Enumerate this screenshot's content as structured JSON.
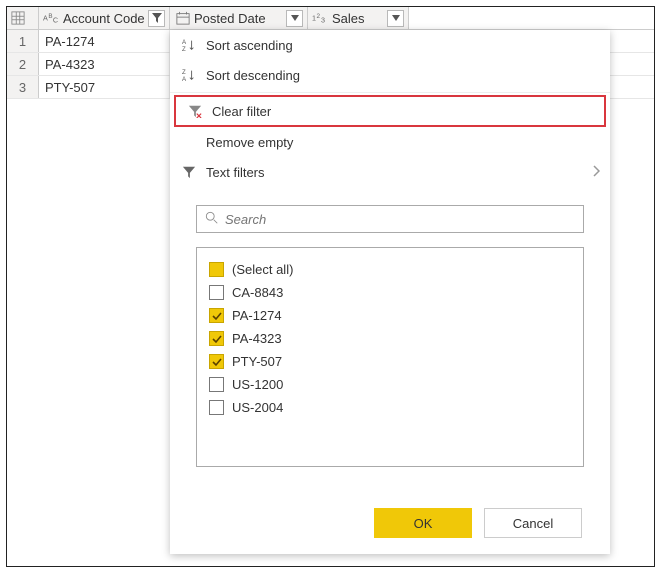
{
  "columns": {
    "c1": {
      "label": "Account Code",
      "datatype": "ABC"
    },
    "c2": {
      "label": "Posted Date",
      "datatype": "date"
    },
    "c3": {
      "label": "Sales",
      "datatype": "123"
    }
  },
  "rows": [
    "PA-1274",
    "PA-4323",
    "PTY-507"
  ],
  "menu": {
    "sort_asc": "Sort ascending",
    "sort_desc": "Sort descending",
    "clear_filter": "Clear filter",
    "remove_empty": "Remove empty",
    "text_filters": "Text filters"
  },
  "search": {
    "placeholder": "Search"
  },
  "filter_items": [
    {
      "label": "(Select all)",
      "state": "partial"
    },
    {
      "label": "CA-8843",
      "state": "unchecked"
    },
    {
      "label": "PA-1274",
      "state": "checked"
    },
    {
      "label": "PA-4323",
      "state": "checked"
    },
    {
      "label": "PTY-507",
      "state": "checked"
    },
    {
      "label": "US-1200",
      "state": "unchecked"
    },
    {
      "label": "US-2004",
      "state": "unchecked"
    }
  ],
  "buttons": {
    "ok": "OK",
    "cancel": "Cancel"
  }
}
